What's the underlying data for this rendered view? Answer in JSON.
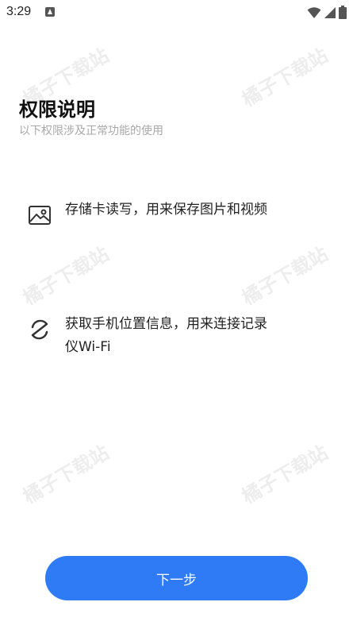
{
  "status_bar": {
    "time": "3:29",
    "notification_icon": "app-notification-icon",
    "icons": [
      "wifi-icon",
      "signal-icon",
      "battery-icon"
    ]
  },
  "watermark": {
    "text": "橘子下载站"
  },
  "header": {
    "title": "权限说明",
    "subtitle": "以下权限涉及正常功能的使用"
  },
  "permissions": [
    {
      "icon": "image-icon",
      "text": "存储卡读写，用来保存图片和视频"
    },
    {
      "icon": "location-link-icon",
      "text": "获取手机位置信息，用来连接记录仪Wi-Fi"
    }
  ],
  "footer": {
    "next_label": "下一步"
  },
  "colors": {
    "accent": "#2f7bf6",
    "title": "#111111",
    "subtitle": "#a8a8a8",
    "text": "#222222"
  }
}
